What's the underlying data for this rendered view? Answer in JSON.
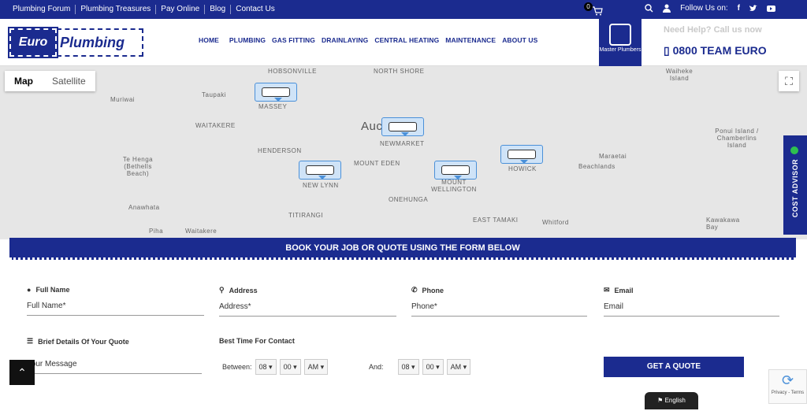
{
  "topbar": {
    "links": [
      "Plumbing Forum",
      "Plumbing Treasures",
      "Pay Online",
      "Blog",
      "Contact Us"
    ],
    "cart_count": "0",
    "follow_label": "Follow Us on:"
  },
  "header": {
    "logo_left": "Euro",
    "logo_right": "Plumbing",
    "nav": [
      "HOME",
      "PLUMBING",
      "GAS FITTING",
      "DRAINLAYING",
      "CENTRAL HEATING",
      "MAINTENANCE",
      "ABOUT US"
    ],
    "master_label": "Master Plumbers",
    "help_text": "Need Help? Call us now",
    "phone": "0800 TEAM EURO"
  },
  "map": {
    "toggle_map": "Map",
    "toggle_satellite": "Satellite",
    "places": [
      {
        "label": "HOBSONVILLE"
      },
      {
        "label": "NORTH SHORE"
      },
      {
        "label": "Waiheke Island"
      },
      {
        "label": "Taupaki"
      },
      {
        "label": "Muriwai"
      },
      {
        "label": "MASSEY"
      },
      {
        "label": "WAITAKERE"
      },
      {
        "label": "Auckland"
      },
      {
        "label": "NEWMARKET"
      },
      {
        "label": "HENDERSON"
      },
      {
        "label": "Ponui Island / Chamberlins Island"
      },
      {
        "label": "Te Henga (Bethells Beach)"
      },
      {
        "label": "MOUNT EDEN"
      },
      {
        "label": "HOWICK"
      },
      {
        "label": "Maraetai"
      },
      {
        "label": "Beachlands"
      },
      {
        "label": "NEW LYNN"
      },
      {
        "label": "MOUNT WELLINGTON"
      },
      {
        "label": "ONEHUNGA"
      },
      {
        "label": "Anawhata"
      },
      {
        "label": "TITIRANGI"
      },
      {
        "label": "EAST TAMAKI"
      },
      {
        "label": "Whitford"
      },
      {
        "label": "Kawakawa Bay"
      },
      {
        "label": "Piha"
      },
      {
        "label": "Waitakere"
      }
    ]
  },
  "cost_advisor": "COST ADVISOR",
  "banner": "BOOK YOUR JOB OR QUOTE USING THE FORM BELOW",
  "form": {
    "full_name_label": "Full Name",
    "full_name_placeholder": "Full Name*",
    "address_label": "Address",
    "address_placeholder": "Address*",
    "phone_label": "Phone",
    "phone_placeholder": "Phone*",
    "email_label": "Email",
    "email_placeholder": "Email",
    "details_label": "Brief Details Of Your Quote",
    "details_placeholder": "Your Message",
    "time_label": "Best Time For Contact",
    "between_label": "Between:",
    "and_label": "And:",
    "between_hour": "08",
    "between_min": "00",
    "between_ampm": "AM",
    "and_hour": "08",
    "and_min": "00",
    "and_ampm": "AM",
    "submit": "GET A QUOTE"
  },
  "language": "English",
  "recaptcha": "Privacy - Terms"
}
